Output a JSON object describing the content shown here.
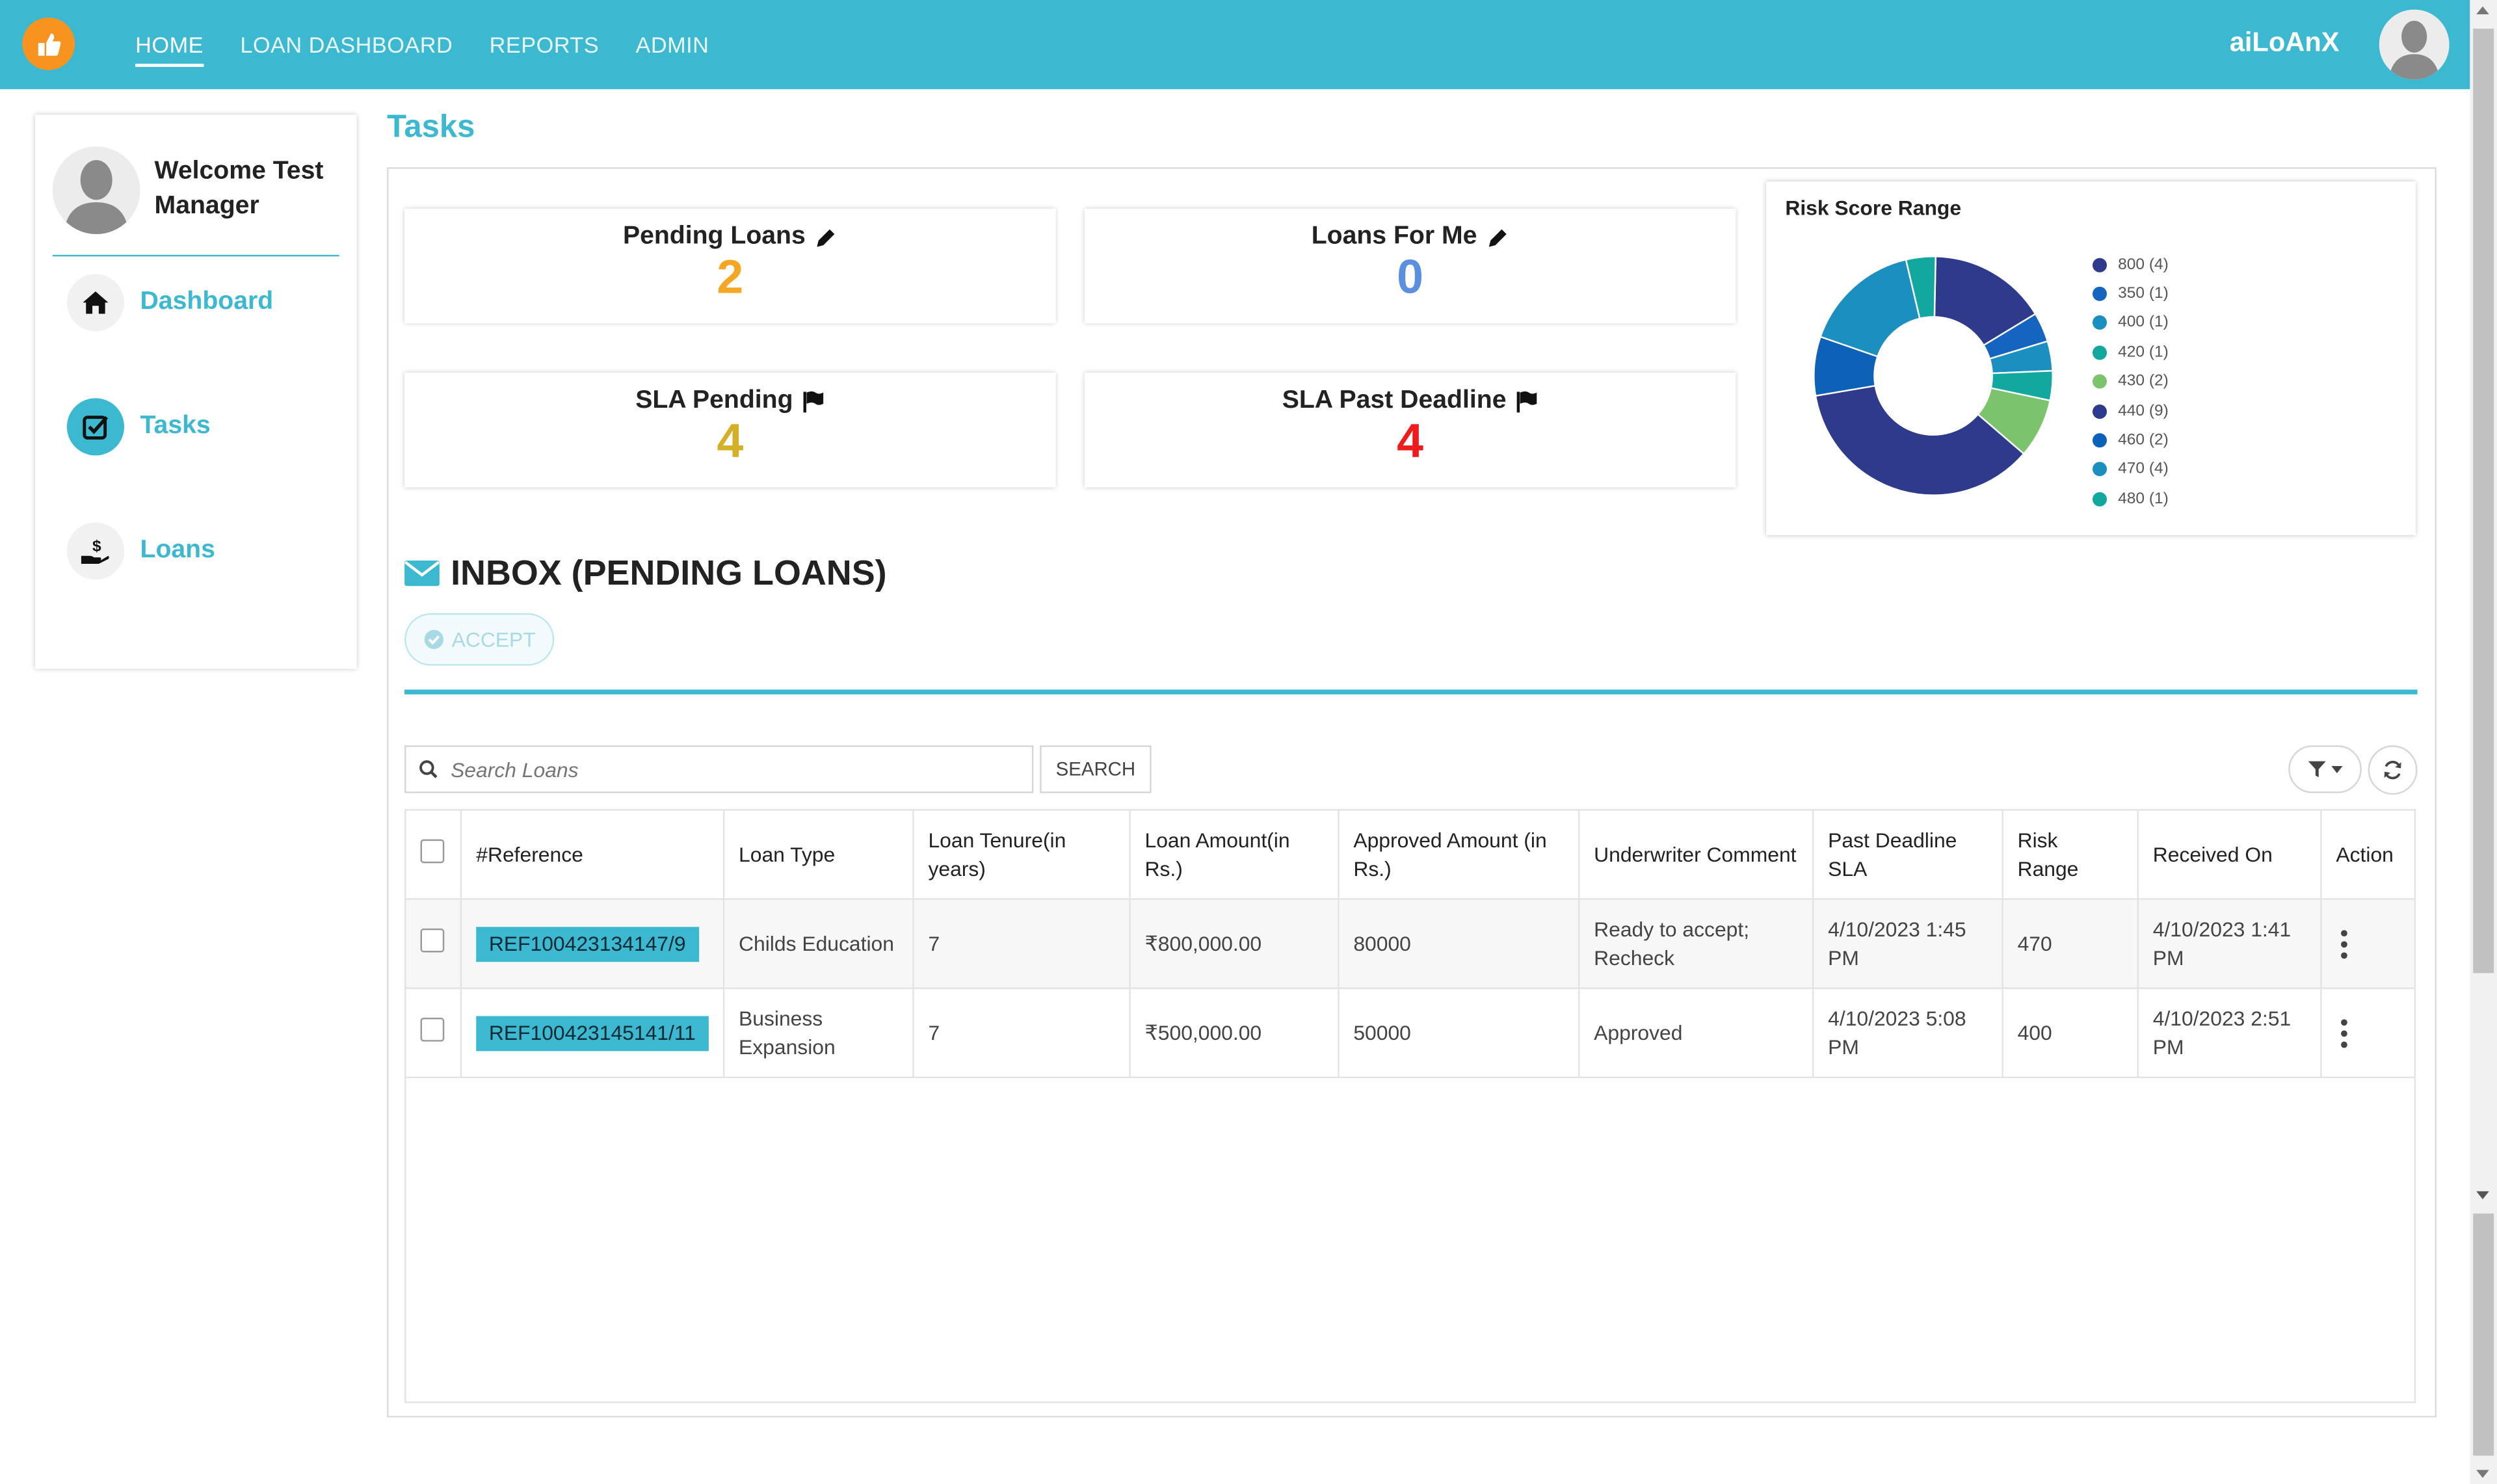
{
  "nav": {
    "items": [
      {
        "label": "HOME",
        "active": true
      },
      {
        "label": "LOAN DASHBOARD"
      },
      {
        "label": "REPORTS"
      },
      {
        "label": "ADMIN"
      }
    ],
    "app_name": "aiLoAnX"
  },
  "sidebar": {
    "welcome": "Welcome Test Manager",
    "items": [
      {
        "label": "Dashboard",
        "icon": "home-icon"
      },
      {
        "label": "Tasks",
        "icon": "checkbox-icon",
        "active": true
      },
      {
        "label": "Loans",
        "icon": "money-hand-icon"
      }
    ]
  },
  "page_title": "Tasks",
  "stats": [
    {
      "title": "Pending Loans",
      "value": "2",
      "color": "#f5a623"
    },
    {
      "title": "Loans For Me",
      "value": "0",
      "color": "#5b8fe0"
    },
    {
      "title": "SLA Pending",
      "value": "4",
      "color": "#d4b028"
    },
    {
      "title": "SLA Past Deadline",
      "value": "4",
      "color": "#ee1c1c"
    }
  ],
  "risk_chart": {
    "title": "Risk Score Range"
  },
  "chart_data": {
    "type": "pie",
    "title": "Risk Score Range",
    "donut": true,
    "legend_position": "right",
    "categories": [
      "800 (4)",
      "350 (1)",
      "400 (1)",
      "420 (1)",
      "430 (2)",
      "440 (9)",
      "460 (2)",
      "470 (4)",
      "480 (1)"
    ],
    "values": [
      4,
      1,
      1,
      1,
      2,
      9,
      2,
      4,
      1
    ],
    "colors": [
      "#2e3a8c",
      "#1565c0",
      "#1a8fc0",
      "#12a8a0",
      "#7cc36e",
      "#2e3a8c",
      "#0d62b8",
      "#1a8fc0",
      "#12a8a0"
    ]
  },
  "inbox": {
    "title": "INBOX (PENDING LOANS)",
    "accept_label": "ACCEPT",
    "search_placeholder": "Search Loans",
    "search_button": "SEARCH"
  },
  "table": {
    "headers": [
      "#Reference",
      "Loan Type",
      "Loan Tenure(in years)",
      "Loan Amount(in Rs.)",
      "Approved Amount (in Rs.)",
      "Underwriter Comment",
      "Past Deadline SLA",
      "Risk Range",
      "Received On",
      "Action"
    ],
    "rows": [
      {
        "reference": "REF100423134147/9",
        "loan_type": "Childs Education",
        "tenure": "7",
        "amount": "₹800,000.00",
        "approved": "80000",
        "comment": "Ready to accept; Recheck",
        "deadline": "4/10/2023 1:45 PM",
        "risk": "470",
        "received": "4/10/2023 1:41 PM"
      },
      {
        "reference": "REF100423145141/11",
        "loan_type": "Business Expansion",
        "tenure": "7",
        "amount": "₹500,000.00",
        "approved": "50000",
        "comment": "Approved",
        "deadline": "4/10/2023 5:08 PM",
        "risk": "400",
        "received": "4/10/2023 2:51 PM"
      }
    ]
  }
}
